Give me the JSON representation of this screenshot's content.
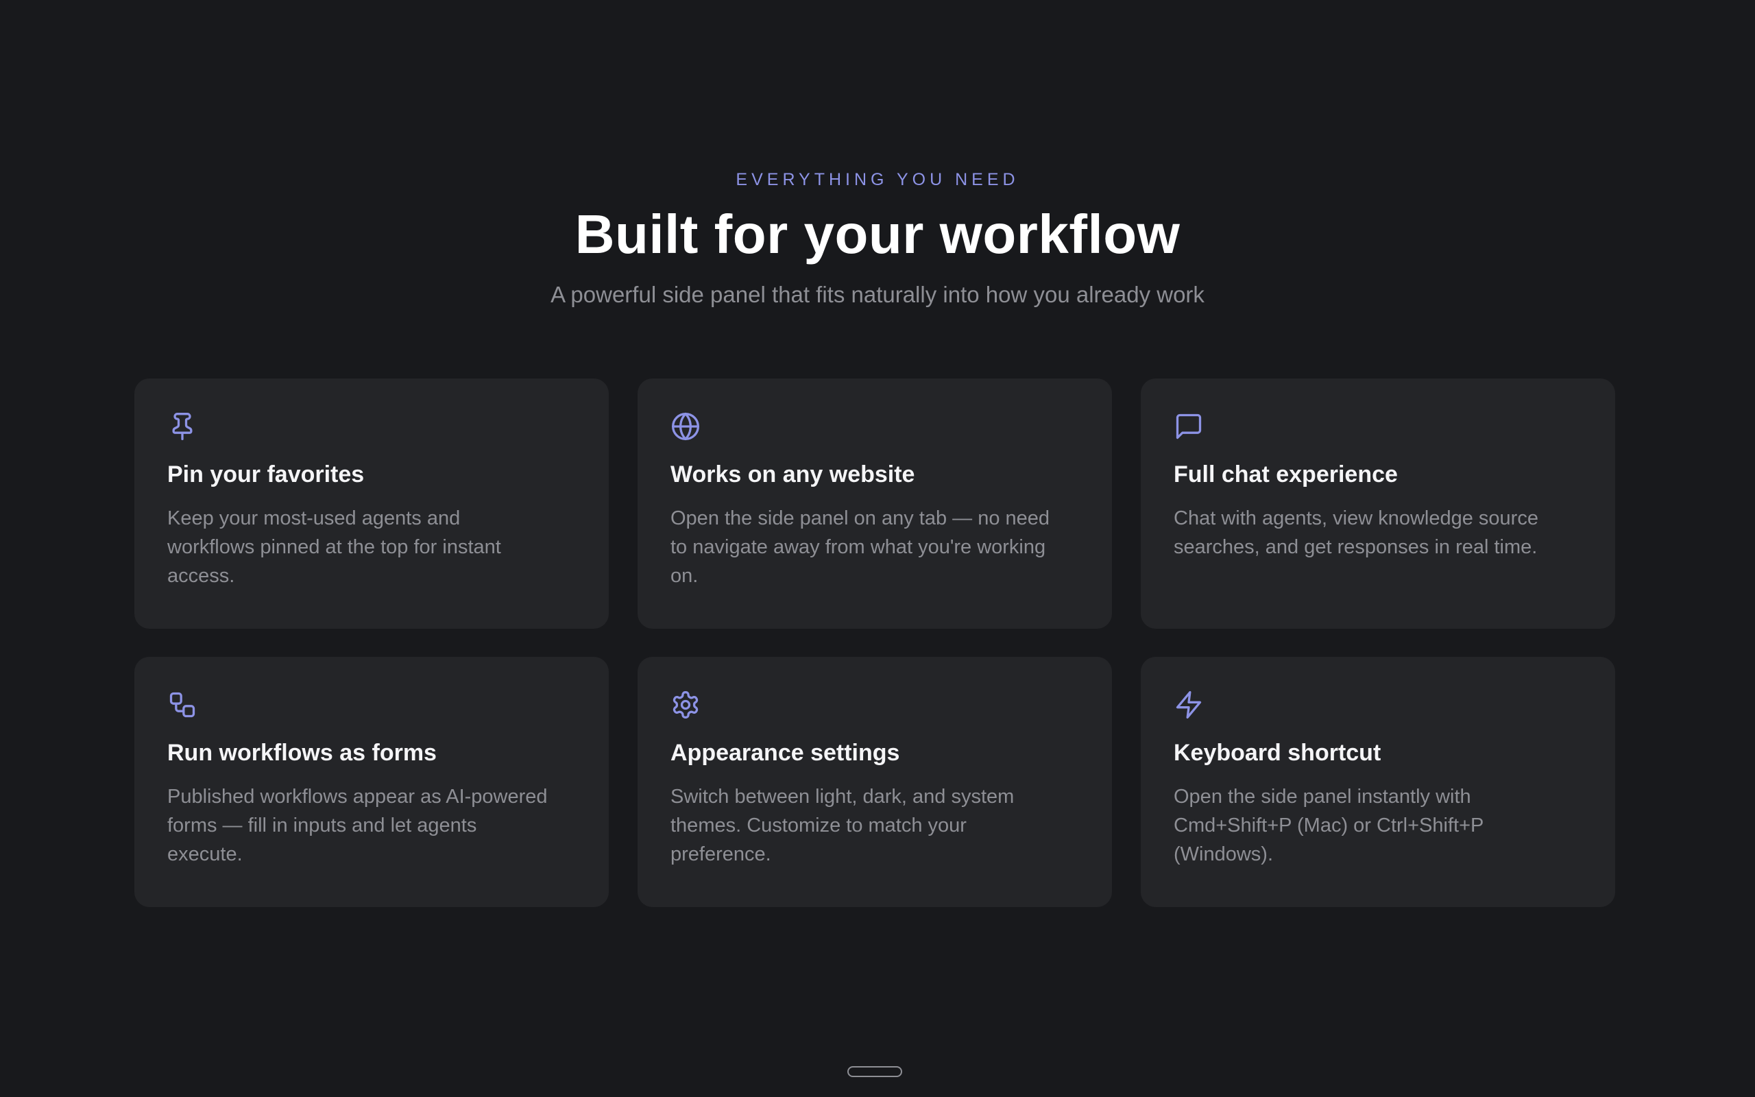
{
  "header": {
    "eyebrow": "EVERYTHING YOU NEED",
    "title": "Built for your workflow",
    "subtitle": "A powerful side panel that fits naturally into how you already work"
  },
  "accent_color": "#8d93e6",
  "features": [
    {
      "icon": "pin-icon",
      "title": "Pin your favorites",
      "description": "Keep your most-used agents and workflows pinned at the top for instant access."
    },
    {
      "icon": "globe-icon",
      "title": "Works on any website",
      "description": "Open the side panel on any tab — no need to navigate away from what you're working on."
    },
    {
      "icon": "chat-bubble-icon",
      "title": "Full chat experience",
      "description": "Chat with agents, view knowledge source searches, and get responses in real time."
    },
    {
      "icon": "workflow-icon",
      "title": "Run workflows as forms",
      "description": "Published workflows appear as AI-powered forms — fill in inputs and let agents execute."
    },
    {
      "icon": "gear-icon",
      "title": "Appearance settings",
      "description": "Switch between light, dark, and system themes. Customize to match your preference."
    },
    {
      "icon": "lightning-icon",
      "title": "Keyboard shortcut",
      "description": "Open the side panel instantly with Cmd+Shift+P (Mac) or Ctrl+Shift+P (Windows)."
    }
  ]
}
